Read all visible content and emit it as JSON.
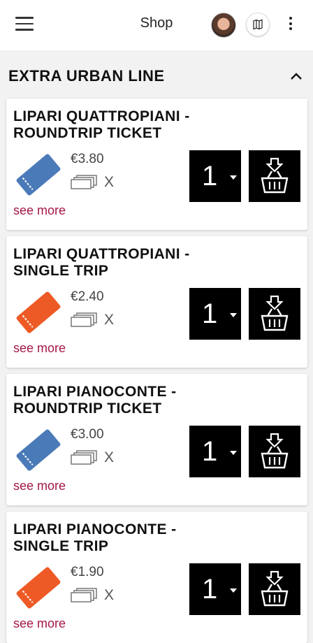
{
  "appbar": {
    "title": "Shop",
    "menu_icon": "hamburger-menu-icon",
    "avatar": "user-avatar",
    "lang_icon": "map-icon",
    "more_icon": "more-vertical-icon"
  },
  "section": {
    "title": "EXTRA URBAN LINE",
    "toggle_icon": "chevron-up-icon"
  },
  "colors": {
    "ticket_blue": "#4a7ab8",
    "ticket_orange": "#ee5a26",
    "see_more": "#a4174a",
    "button_bg": "#000000"
  },
  "products": [
    {
      "name": "LIPARI QUATTROPIANI - ROUNDTRIP TICKET",
      "price": "€3.80",
      "qty_mult": "X",
      "see_more": "see more",
      "quantity": "1",
      "ticket_color": "blue"
    },
    {
      "name": "LIPARI QUATTROPIANI - SINGLE TRIP",
      "price": "€2.40",
      "qty_mult": "X",
      "see_more": "see more",
      "quantity": "1",
      "ticket_color": "orange"
    },
    {
      "name": "LIPARI PIANOCONTE - ROUNDTRIP TICKET",
      "price": "€3.00",
      "qty_mult": "X",
      "see_more": "see more",
      "quantity": "1",
      "ticket_color": "blue"
    },
    {
      "name": "LIPARI PIANOCONTE - SINGLE TRIP",
      "price": "€1.90",
      "qty_mult": "X",
      "see_more": "see more",
      "quantity": "1",
      "ticket_color": "orange"
    }
  ]
}
